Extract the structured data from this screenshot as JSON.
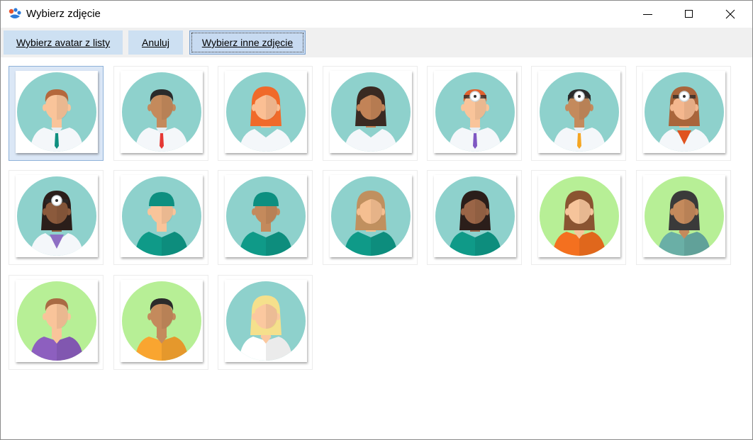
{
  "window": {
    "title": "Wybierz zdjęcie",
    "controls": [
      "minimize",
      "maximize",
      "close"
    ]
  },
  "toolbar": {
    "choose_from_list_label": "Wybierz avatar z listy",
    "cancel_label": "Anuluj",
    "choose_other_label": "Wybierz inne zdjęcie"
  },
  "avatars": [
    {
      "id": 1,
      "bg": "#8ed1cc",
      "skin": "#f9c49a",
      "hair": "#b4683c",
      "style": "doctor",
      "accent": "#0f8f7f",
      "mirror": false,
      "selected": true
    },
    {
      "id": 2,
      "bg": "#8ed1cc",
      "skin": "#c48a5c",
      "hair": "#2b2b2b",
      "style": "doctor",
      "accent": "#e53935",
      "mirror": false
    },
    {
      "id": 3,
      "bg": "#8ed1cc",
      "skin": "#fbbf94",
      "hair": "#f06a2a",
      "style": "nurse",
      "accent": "#ffffff",
      "mirror": false
    },
    {
      "id": 4,
      "bg": "#8ed1cc",
      "skin": "#c28357",
      "hair": "#3a2a22",
      "style": "nurse",
      "accent": "#ffffff",
      "mirror": false
    },
    {
      "id": 5,
      "bg": "#8ed1cc",
      "skin": "#f9c49a",
      "hair": "#e0622e",
      "style": "doctor-mirror",
      "accent": "#7e57c2",
      "mirror": true
    },
    {
      "id": 6,
      "bg": "#8ed1cc",
      "skin": "#c48a5c",
      "hair": "#2b2b2b",
      "style": "doctor-mirror",
      "accent": "#f5a623",
      "mirror": true
    },
    {
      "id": 7,
      "bg": "#8ed1cc",
      "skin": "#f4b78e",
      "hair": "#a9653b",
      "style": "nurse-mirror",
      "accent": "#e0531f",
      "mirror": true
    },
    {
      "id": 8,
      "bg": "#8ed1cc",
      "skin": "#8b5a3c",
      "hair": "#2b1e1a",
      "style": "nurse-mirror",
      "accent": "#8e6fc4",
      "mirror": true
    },
    {
      "id": 9,
      "bg": "#8ed1cc",
      "skin": "#f9c49a",
      "hair": "#0d8f80",
      "style": "surgeon",
      "accent": "#0f9a88",
      "mirror": false
    },
    {
      "id": 10,
      "bg": "#8ed1cc",
      "skin": "#c48a5c",
      "hair": "#0d8f80",
      "style": "surgeon",
      "accent": "#0f9a88",
      "mirror": false
    },
    {
      "id": 11,
      "bg": "#8ed1cc",
      "skin": "#f5bf91",
      "hair": "#c0905f",
      "style": "scrubs-female",
      "accent": "#0f9a88",
      "mirror": false
    },
    {
      "id": 12,
      "bg": "#8ed1cc",
      "skin": "#9a6547",
      "hair": "#2b1e1a",
      "style": "scrubs-female",
      "accent": "#0f9a88",
      "mirror": false
    },
    {
      "id": 13,
      "bg": "#b7ef96",
      "skin": "#f6c49b",
      "hair": "#8a5431",
      "style": "casual-female",
      "accent": "#f4701f",
      "mirror": false
    },
    {
      "id": 14,
      "bg": "#b7ef96",
      "skin": "#c48a5c",
      "hair": "#3a3a3a",
      "style": "casual-female",
      "accent": "#6aafa6",
      "mirror": false
    },
    {
      "id": 15,
      "bg": "#b7ef96",
      "skin": "#f9c49a",
      "hair": "#a96b44",
      "style": "casual-male",
      "accent": "#8d5fbf",
      "mirror": false
    },
    {
      "id": 16,
      "bg": "#b7ef96",
      "skin": "#c48a5c",
      "hair": "#2b2b2b",
      "style": "casual-male",
      "accent": "#f9a530",
      "mirror": false
    },
    {
      "id": 17,
      "bg": "#8ed1cc",
      "skin": "#fbc89f",
      "hair": "#f5e08c",
      "style": "casual-female",
      "accent": "#ffffff",
      "mirror": false
    }
  ]
}
